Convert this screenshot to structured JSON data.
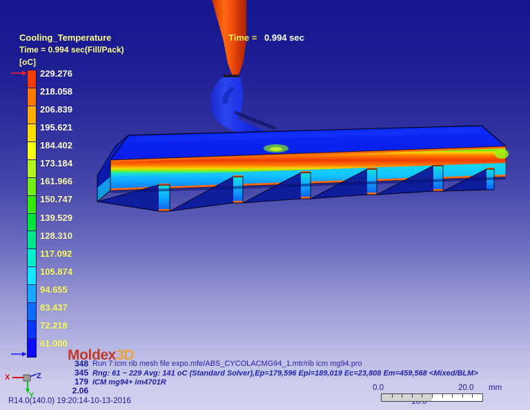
{
  "legend": {
    "title": "Cooling_Temperature",
    "subtitle": "Time = 0.994 sec(Fill/Pack)",
    "unit": "[oC]",
    "values": [
      "229.276",
      "218.058",
      "206.839",
      "195.621",
      "184.402",
      "173.184",
      "161.966",
      "150.747",
      "139.529",
      "128.310",
      "117.092",
      "105.874",
      "94.655",
      "83.437",
      "72.218",
      "61.000"
    ],
    "colors": [
      "#f23c08",
      "#ff7a00",
      "#ffae00",
      "#ffdd00",
      "#f6ff1a",
      "#b4f520",
      "#76ee16",
      "#34e80a",
      "#00e53a",
      "#00e88d",
      "#00f0cc",
      "#13e6ff",
      "#17a8ff",
      "#0b6cff",
      "#0a34ff",
      "#0a0aff"
    ],
    "max_arrow": "max-indicator",
    "min_arrow": "min-indicator"
  },
  "overlay": {
    "time_label": "Time =",
    "time_value": "0.994 sec"
  },
  "brand": {
    "name_primary": "Moldex",
    "name_secondary": "3D"
  },
  "stats": {
    "lines": [
      "348",
      "345",
      "179",
      "2.06"
    ]
  },
  "info": {
    "line1": "Run 7:icm rib mesh file expo.mfe/ABS_CYCOLACMG94_1.mtr/rib icm mg94.pro",
    "line2": "Rng: 61 ~ 229   Avg: 141 oC (Standard Solver),Ep=179,596 Epi=189,019 Ec=23,808 Em=459,568  <Mixed/BLM>",
    "line3": "ICM mg94+ im4701R"
  },
  "footer": {
    "version_timestamp": "R14.0(140.0) 19:20:14-10-13-2016"
  },
  "axes": {
    "x_label": "X",
    "y_label": "Y",
    "z_label": "Z"
  },
  "ruler": {
    "start": "0.0",
    "mid": "10.0",
    "end": "20.0",
    "unit": "mm"
  },
  "chart_data": {
    "type": "heatmap",
    "title": "Cooling_Temperature",
    "subtitle": "Time = 0.994 sec(Fill/Pack)",
    "unit": "oC",
    "colorbar_min": 61.0,
    "colorbar_max": 229.276,
    "range_min": 61,
    "range_max": 229,
    "average": 141,
    "levels": [
      229.276,
      218.058,
      206.839,
      195.621,
      184.402,
      173.184,
      161.966,
      150.747,
      139.529,
      128.31,
      117.092,
      105.874,
      94.655,
      83.437,
      72.218,
      61.0
    ],
    "solver": "Standard Solver",
    "mesh": {
      "Ep": 179596,
      "Epi": 189019,
      "Ec": 23808,
      "Em": 459568,
      "type": "Mixed/BLM"
    },
    "element_counts": [
      348,
      345,
      179,
      2.06
    ],
    "scale_bar_mm": [
      0.0,
      10.0,
      20.0
    ]
  }
}
